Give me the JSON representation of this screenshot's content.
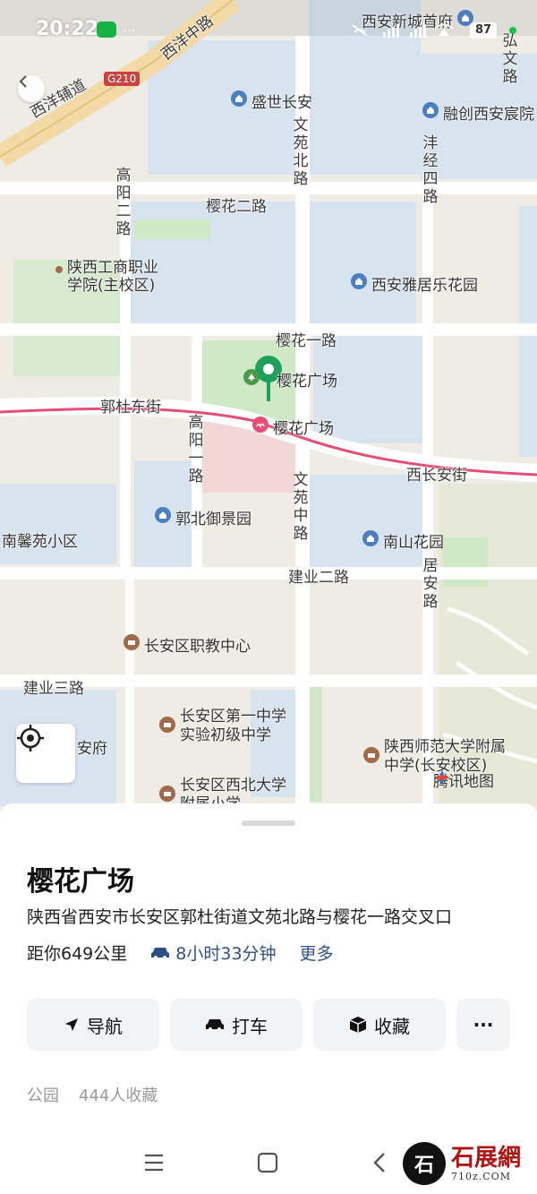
{
  "status_bar": {
    "time": "20:22",
    "battery": "87"
  },
  "map": {
    "roads": {
      "xiyang_zhong": "西洋中路",
      "xiyang_fu": "西洋辅道",
      "g210": "G210",
      "yinghua_er": "樱花二路",
      "yinghua_yi": "樱花一路",
      "guodu_dong": "郭杜东街",
      "xichang": "西长安街",
      "jianye_er": "建业二路",
      "jianye_san": "建业三路",
      "wenyuan_bei": "文苑北路",
      "wenyuan_zhong": "文苑中路",
      "gaoyang_er": "高阳二路",
      "gaoyang_yi": "高阳一路",
      "fengjing_si": "沣经四路",
      "juan": "居安路",
      "hongwen": "弘文路"
    },
    "pois": {
      "xinchengyufu": "西安新城首府",
      "shengshi": "盛世长安",
      "rongchuang": "融创西安宸院",
      "gongshang": "陕西工商职业学院(主校区)",
      "yaju": "西安雅居乐花园",
      "yinghua_park": "樱花广场",
      "yinghua_station": "樱花广场",
      "guobei": "郭北御景园",
      "nanxin": "南馨苑小区",
      "nanshan": "南山花园",
      "zhijiao": "长安区职教中心",
      "diyizhongxue": "长安区第一中学实验初级中学",
      "shida": "陕西师范大学附属中学(长安校区)",
      "xibei": "长安区西北大学附属小学",
      "anfu": "安府"
    },
    "logo": "腾讯地图"
  },
  "place": {
    "title": "樱花广场",
    "address": "陕西省西安市长安区郭杜街道文苑北路与樱花一路交叉口",
    "distance": "距你649公里",
    "drive_time": "8小时33分钟",
    "more": "更多",
    "tags": [
      "公园",
      "444人收藏"
    ]
  },
  "actions": {
    "navigate": "导航",
    "taxi": "打车",
    "favorite": "收藏",
    "more": "···"
  },
  "watermark": {
    "brand": "石展網",
    "domain": "710z.COM",
    "seal": "石"
  },
  "colors": {
    "accent": "#2f4f86",
    "pin": "#1fa05a",
    "metro": "#e24f77"
  }
}
